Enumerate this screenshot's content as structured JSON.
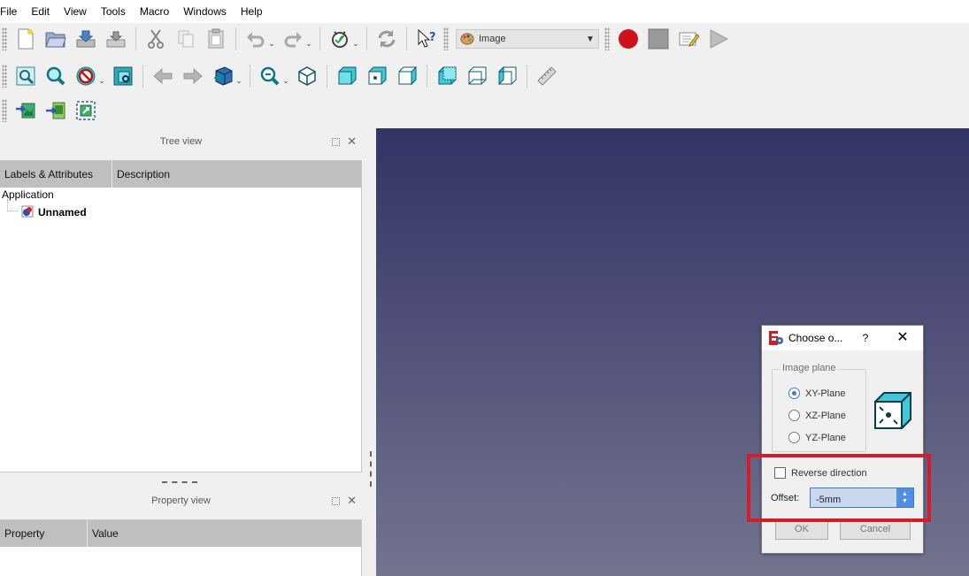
{
  "menubar": {
    "items": [
      "File",
      "Edit",
      "View",
      "Tools",
      "Macro",
      "Windows",
      "Help"
    ]
  },
  "toolbar": {
    "workbench_label": "Image",
    "icons": {
      "row1": [
        "new-document-icon",
        "open-icon",
        "save-icon",
        "save-as-icon",
        "cut-icon",
        "copy-icon",
        "paste-icon",
        "undo-icon",
        "redo-icon",
        "refresh-icon",
        "whats-this-icon",
        "record-macro-icon",
        "stop-macro-icon",
        "edit-macro-icon",
        "run-macro-icon"
      ],
      "row2": [
        "fit-all-icon",
        "fit-selection-icon",
        "draw-style-icon",
        "bounding-box-icon",
        "back-icon",
        "forward-icon",
        "sync-view-icon",
        "std-view-menu-icon",
        "isometric-view-icon",
        "front-view-icon",
        "top-view-icon",
        "right-view-icon",
        "rear-view-icon",
        "bottom-view-icon",
        "left-view-icon",
        "measure-icon"
      ],
      "row3": [
        "image-open-icon",
        "image-import-icon",
        "image-scale-icon"
      ]
    }
  },
  "tree_view": {
    "title": "Tree view",
    "columns": [
      "Labels & Attributes",
      "Description"
    ],
    "root_label": "Application",
    "document_label": "Unnamed"
  },
  "property_view": {
    "title": "Property view",
    "columns": [
      "Property",
      "Value"
    ]
  },
  "dialog": {
    "title": "Choose o...",
    "help_symbol": "?",
    "close_symbol": "✕",
    "group_title": "Image plane",
    "options": [
      {
        "label": "XY-Plane",
        "checked": true
      },
      {
        "label": "XZ-Plane",
        "checked": false
      },
      {
        "label": "YZ-Plane",
        "checked": false
      }
    ],
    "reverse_label": "Reverse direction",
    "reverse_checked": false,
    "offset_label": "Offset:",
    "offset_value": "-5mm",
    "ok_label": "OK",
    "cancel_label": "Cancel"
  },
  "colors": {
    "highlight": "#d51c2a",
    "viewport_top": "#333465",
    "viewport_bottom": "#74748f",
    "accent": "#3b7bd6"
  }
}
